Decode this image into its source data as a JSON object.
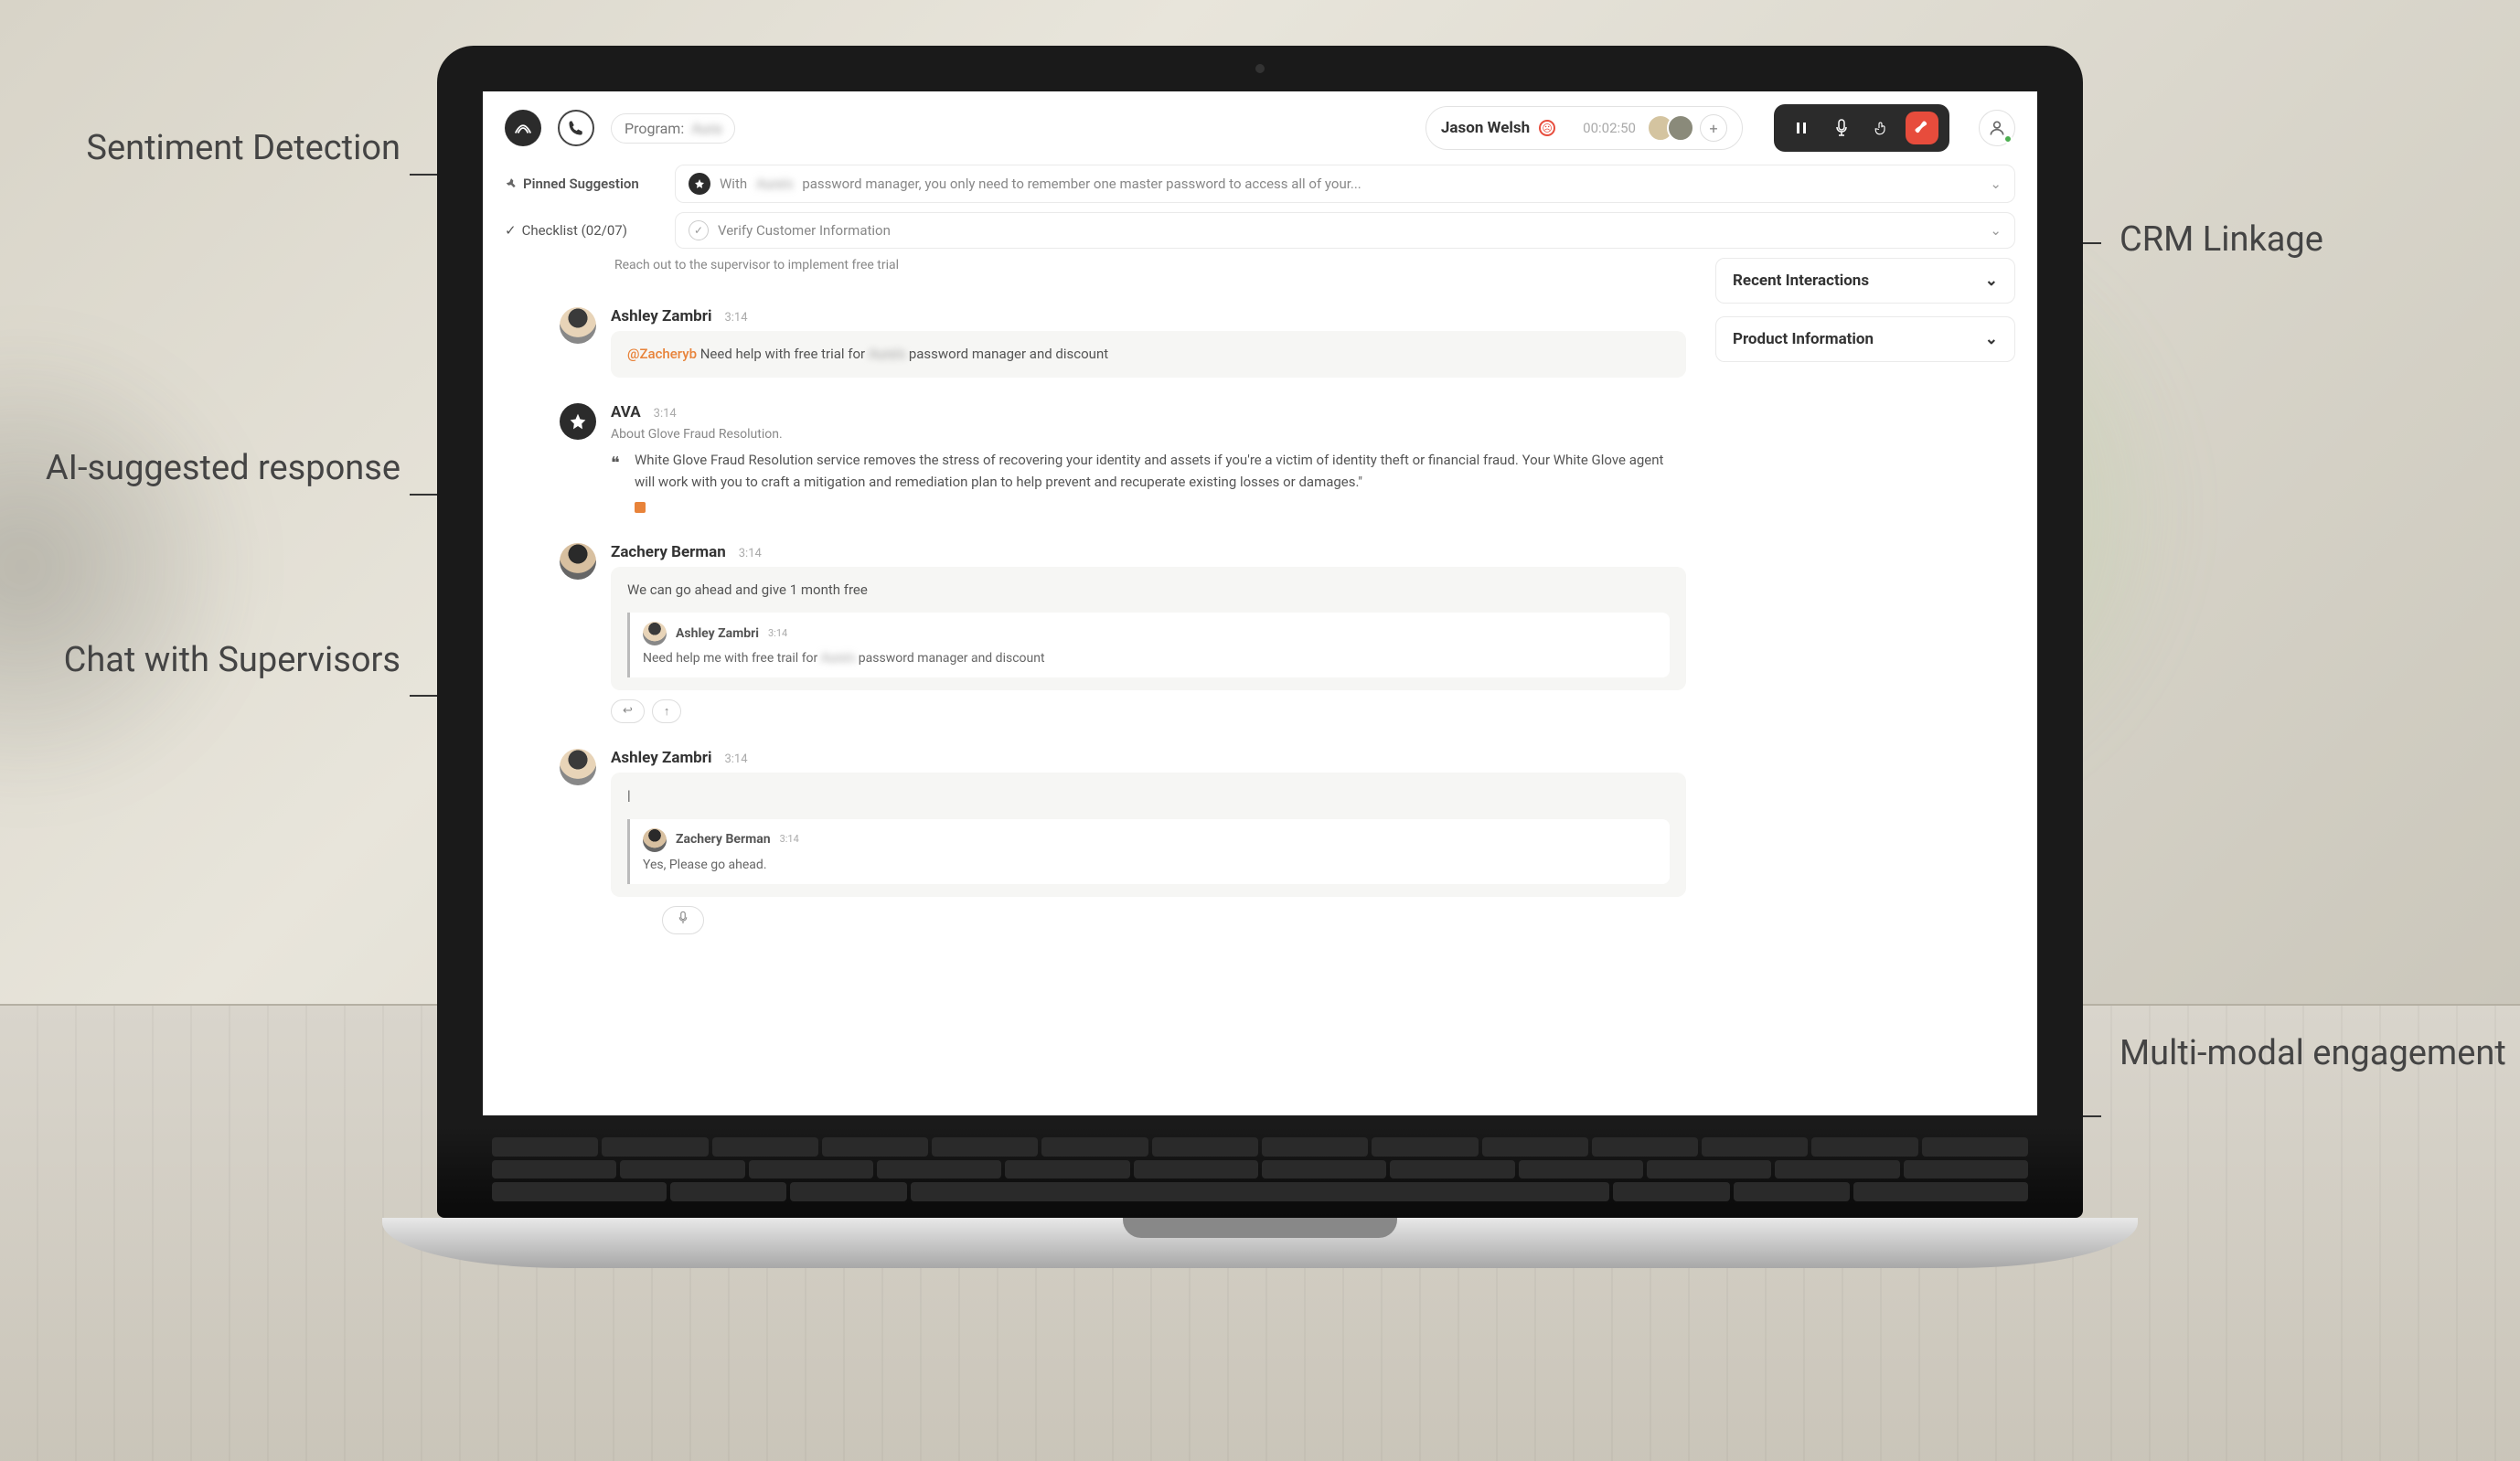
{
  "callouts": {
    "sentiment": "Sentiment Detection",
    "ai_response": "AI-suggested response",
    "supervisors": "Chat with Supervisors",
    "crm": "CRM Linkage",
    "multimodal": "Multi-modal engagement"
  },
  "topbar": {
    "program_label": "Program:",
    "program_value": "Aura",
    "caller_name": "Jason Welsh",
    "timer": "00:02:50",
    "add_label": "+"
  },
  "subbar": {
    "pinned_label": "Pinned Suggestion",
    "suggestion_prefix": "With",
    "suggestion_blur": "Aura's",
    "suggestion_text": "password manager, you only need to remember one master password to access all of your...",
    "checklist_label": "Checklist (02/07)",
    "checklist_item": "Verify Customer Information"
  },
  "right_panel": {
    "recent": "Recent Interactions",
    "product": "Product Information"
  },
  "chat": {
    "truncated": "Reach out to the supervisor to implement free trial",
    "m1": {
      "name": "Ashley Zambri",
      "time": "3:14",
      "mention": "@Zacheryb",
      "text_prefix": "Need help with free trial for",
      "text_blur": "Aura's",
      "text_suffix": "password manager and discount"
    },
    "m2": {
      "name": "AVA",
      "time": "3:14",
      "desc": "About Glove Fraud Resolution.",
      "quote": "White Glove Fraud Resolution service removes the stress of recovering your identity and assets if you're a victim of identity theft or financial fraud. Your White Glove agent will work with you to craft a mitigation and remediation plan to help prevent and recuperate existing losses or damages.\""
    },
    "m3": {
      "name": "Zachery Berman",
      "time": "3:14",
      "text": "We can go ahead and give 1 month free",
      "nested": {
        "name": "Ashley Zambri",
        "time": "3:14",
        "text_prefix": "Need help me with free trail for",
        "text_blur": "Aura's",
        "text_suffix": "password manager and discount"
      }
    },
    "m4": {
      "name": "Ashley Zambri",
      "time": "3:14",
      "typed": "|",
      "nested": {
        "name": "Zachery Berman",
        "time": "3:14",
        "text": "Yes, Please go ahead."
      }
    }
  }
}
